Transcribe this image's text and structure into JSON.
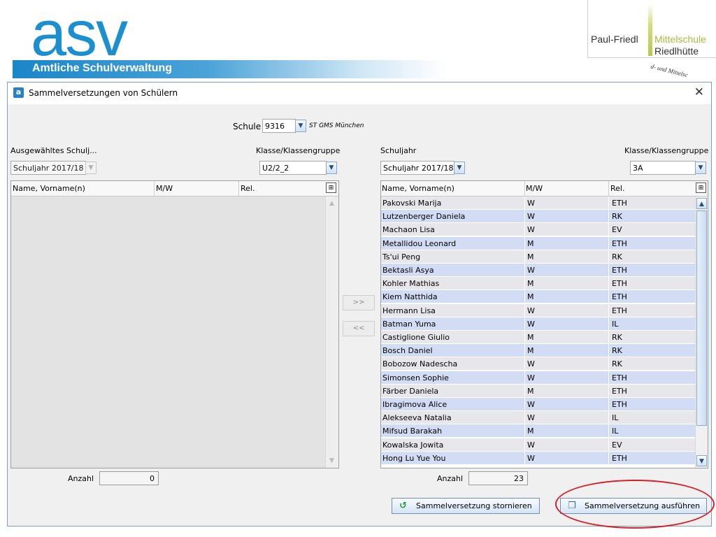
{
  "slide": {
    "logo": "asv",
    "banner": "Amtliche Schulverwaltung",
    "school_name_a": "Paul-Friedl",
    "school_name_b": "Mittelschule",
    "school_name_c": "Riedlhütte",
    "seal_text": "d- und Mittelsc"
  },
  "dialog": {
    "title": "Sammelversetzungen von Schülern",
    "app_icon": "a",
    "close_icon": "✕",
    "schule_label": "Schule",
    "schule_value": "9316",
    "schule_name": "ST GMS München"
  },
  "left": {
    "schuljahr_label": "Ausgewähltes Schulj...",
    "schuljahr_value": "Schuljahr 2017/18",
    "klasse_label": "Klasse/Klassengruppe",
    "klasse_value": "U2/2_2",
    "columns": [
      "Name, Vorname(n)",
      "M/W",
      "Rel."
    ],
    "anzahl_label": "Anzahl",
    "anzahl_value": "0"
  },
  "right": {
    "schuljahr_label": "Schuljahr",
    "schuljahr_value": "Schuljahr 2017/18",
    "klasse_label": "Klasse/Klassengruppe",
    "klasse_value": "3A",
    "columns": [
      "Name, Vorname(n)",
      "M/W",
      "Rel."
    ],
    "anzahl_label": "Anzahl",
    "anzahl_value": "23",
    "rows": [
      {
        "name": "Pakovski Marija",
        "mw": "W",
        "rel": "ETH"
      },
      {
        "name": "Lutzenberger Daniela",
        "mw": "W",
        "rel": "RK"
      },
      {
        "name": "Machaon Lisa",
        "mw": "W",
        "rel": "EV"
      },
      {
        "name": "Metallidou Leonard",
        "mw": "M",
        "rel": "ETH"
      },
      {
        "name": "Ts'ui Peng",
        "mw": "M",
        "rel": "RK"
      },
      {
        "name": "Bektasli Asya",
        "mw": "W",
        "rel": "ETH"
      },
      {
        "name": "Kohler Mathias",
        "mw": "M",
        "rel": "ETH"
      },
      {
        "name": "Kiem Natthida",
        "mw": "M",
        "rel": "ETH"
      },
      {
        "name": "Hermann Lisa",
        "mw": "W",
        "rel": "ETH"
      },
      {
        "name": "Batman Yuma",
        "mw": "W",
        "rel": "IL"
      },
      {
        "name": "Castiglione Giulio",
        "mw": "M",
        "rel": "RK"
      },
      {
        "name": "Bosch Daniel",
        "mw": "M",
        "rel": "RK"
      },
      {
        "name": "Bobozow Nadescha",
        "mw": "W",
        "rel": "RK"
      },
      {
        "name": "Simonsen Sophie",
        "mw": "W",
        "rel": "ETH"
      },
      {
        "name": "Färber Daniela",
        "mw": "M",
        "rel": "ETH"
      },
      {
        "name": "Ibragimova Alice",
        "mw": "W",
        "rel": "ETH"
      },
      {
        "name": "Alekseeva Natalia",
        "mw": "W",
        "rel": "IL"
      },
      {
        "name": "Mifsud Barakah",
        "mw": "M",
        "rel": "IL"
      },
      {
        "name": "Kowalska Jowita",
        "mw": "W",
        "rel": "EV"
      },
      {
        "name": "Hong Lu Yue You",
        "mw": "W",
        "rel": "ETH"
      }
    ]
  },
  "buttons": {
    "move_right": ">>",
    "move_left": "<<",
    "cancel": "Sammelversetzung stornieren",
    "execute": "Sammelversetzung ausführen"
  },
  "icons": {
    "dropdown": "▼",
    "scroll_up": "▲",
    "scroll_down": "▼",
    "column_chooser": "⊞",
    "undo": "↺",
    "execute": "❐"
  },
  "colors": {
    "row_alt": "#d2dcf4",
    "row_norm": "#e7e7eb",
    "accent": "#1c8fd0",
    "highlight_ring": "#d61f26"
  }
}
